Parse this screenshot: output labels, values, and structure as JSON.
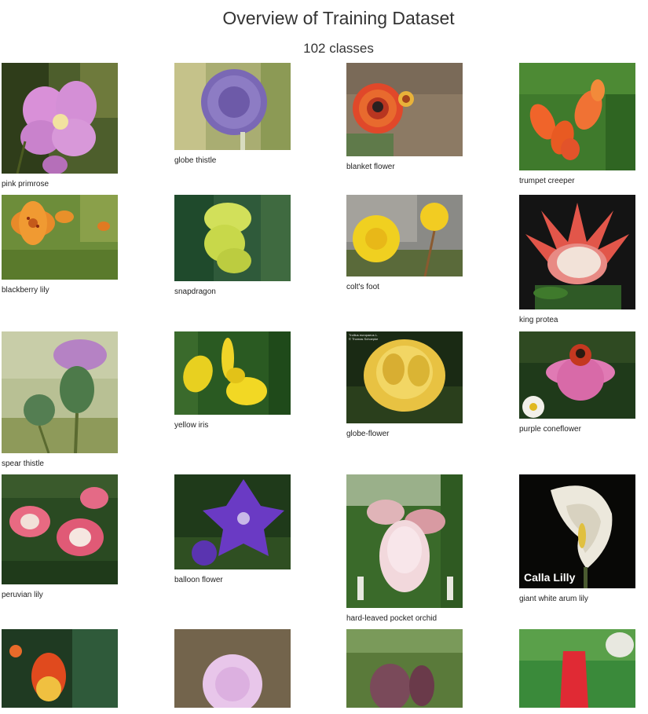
{
  "header": {
    "title": "Overview of Training Dataset",
    "subtitle": "102 classes"
  },
  "flowers": [
    {
      "label": "pink primrose"
    },
    {
      "label": "globe thistle"
    },
    {
      "label": "blanket flower"
    },
    {
      "label": "trumpet creeper"
    },
    {
      "label": "blackberry lily"
    },
    {
      "label": "snapdragon"
    },
    {
      "label": "colt's foot"
    },
    {
      "label": "king protea"
    },
    {
      "label": "spear thistle"
    },
    {
      "label": "yellow iris"
    },
    {
      "label": "globe-flower"
    },
    {
      "label": "purple coneflower"
    },
    {
      "label": "peruvian lily"
    },
    {
      "label": "balloon flower"
    },
    {
      "label": "hard-leaved pocket orchid"
    },
    {
      "label": "giant white arum lily",
      "overlay_text": "Calla Lilly"
    },
    {
      "label": ""
    },
    {
      "label": ""
    },
    {
      "label": ""
    },
    {
      "label": ""
    }
  ],
  "globe_flower_watermark": "Trollius europaeus L.\n© Thomas Schoepke",
  "colors": {
    "title": "#333333",
    "caption": "#222222",
    "background": "#ffffff"
  }
}
